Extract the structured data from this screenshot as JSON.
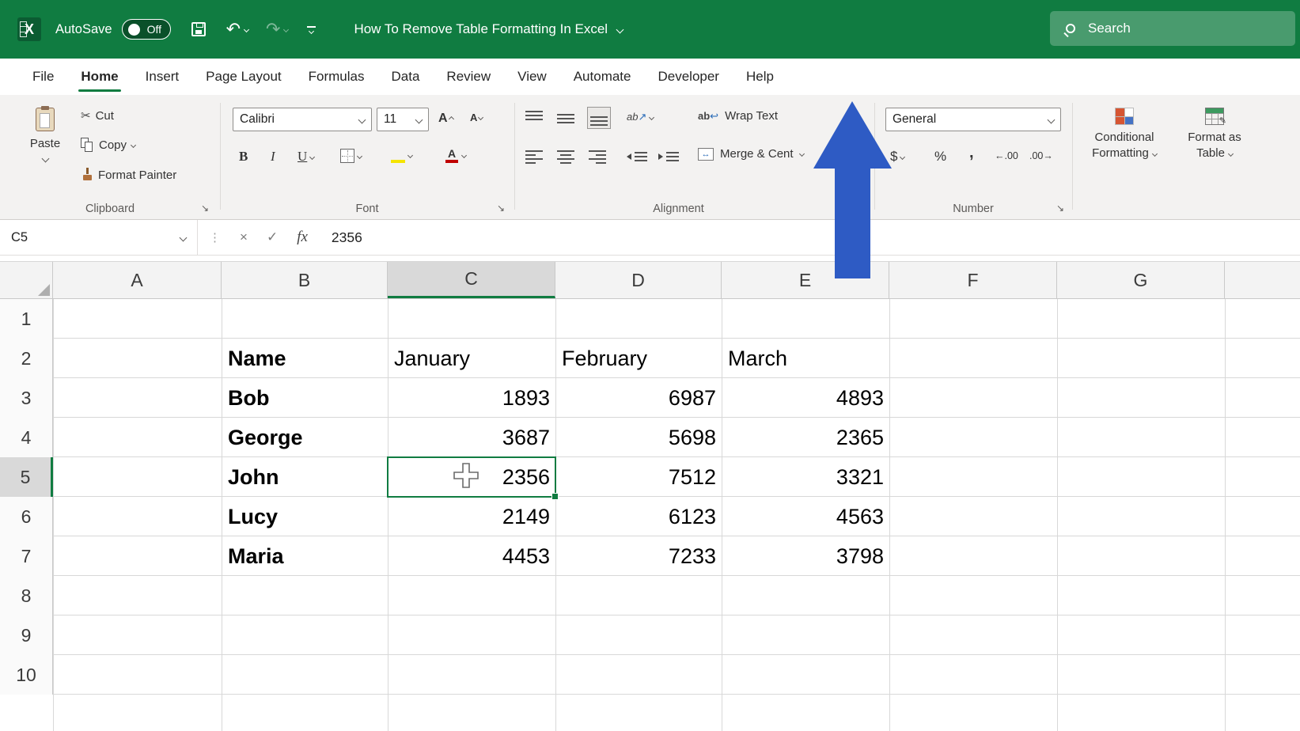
{
  "titlebar": {
    "autosave_label": "AutoSave",
    "autosave_state": "Off",
    "document_title": "How To Remove Table Formatting In Excel",
    "search_label": "Search"
  },
  "menubar": {
    "active": "Home",
    "items": [
      {
        "label": "File"
      },
      {
        "label": "Home"
      },
      {
        "label": "Insert"
      },
      {
        "label": "Page Layout"
      },
      {
        "label": "Formulas"
      },
      {
        "label": "Data"
      },
      {
        "label": "Review"
      },
      {
        "label": "View"
      },
      {
        "label": "Automate"
      },
      {
        "label": "Developer"
      },
      {
        "label": "Help"
      }
    ]
  },
  "ribbon": {
    "clipboard": {
      "label": "Clipboard",
      "paste": "Paste",
      "cut": "Cut",
      "copy": "Copy",
      "format_painter": "Format Painter"
    },
    "font": {
      "label": "Font",
      "family": "Calibri",
      "size": "11",
      "grow_letter": "A",
      "shrink_letter": "A",
      "bold": "B",
      "italic": "I",
      "underline": "U",
      "font_color_letter": "A"
    },
    "alignment": {
      "label": "Alignment",
      "wrap_text": "Wrap Text",
      "merge_center": "Merge & Cent"
    },
    "number": {
      "label": "Number",
      "format": "General",
      "currency": "$",
      "percent": "%",
      "comma": ",",
      "increase_decimal": "←.00",
      "decrease_decimal": ".00→"
    },
    "styles": {
      "conditional_formatting_line1": "Conditional",
      "conditional_formatting_line2": "Formatting",
      "format_as_table_line1": "Format as",
      "format_as_table_line2": "Table"
    }
  },
  "formula_bar": {
    "name_box": "C5",
    "fx": "fx",
    "value": "2356"
  },
  "sheet": {
    "columns": [
      "A",
      "B",
      "C",
      "D",
      "E",
      "F",
      "G"
    ],
    "rows": [
      "1",
      "2",
      "3",
      "4",
      "5",
      "6",
      "7",
      "8",
      "9",
      "10"
    ],
    "selected": {
      "cell": "C5",
      "column": "C",
      "row": "5"
    },
    "cells": {
      "B2": "Name",
      "C2": "January",
      "D2": "February",
      "E2": "March",
      "B3": "Bob",
      "C3": "1893",
      "D3": "6987",
      "E3": "4893",
      "B4": "George",
      "C4": "3687",
      "D4": "5698",
      "E4": "2365",
      "B5": "John",
      "C5": "2356",
      "D5": "7512",
      "E5": "3321",
      "B6": "Lucy",
      "C6": "2149",
      "D6": "6123",
      "E6": "4563",
      "B7": "Maria",
      "C7": "4453",
      "D7": "7233",
      "E7": "3798"
    }
  },
  "icons": {
    "cut": "✂",
    "undo": "↶",
    "redo": "↷",
    "close": "×",
    "check": "✓",
    "more": "⋮",
    "launcher": "↘",
    "orientation_text": "ab",
    "orientation_arrow": "↗",
    "wrap_text_letters": "ab",
    "wrap_arrow": "↩",
    "merge_arrows": "↔",
    "pencil": "✎"
  },
  "annotation": {
    "arrow_color": "#2E5BC4"
  }
}
